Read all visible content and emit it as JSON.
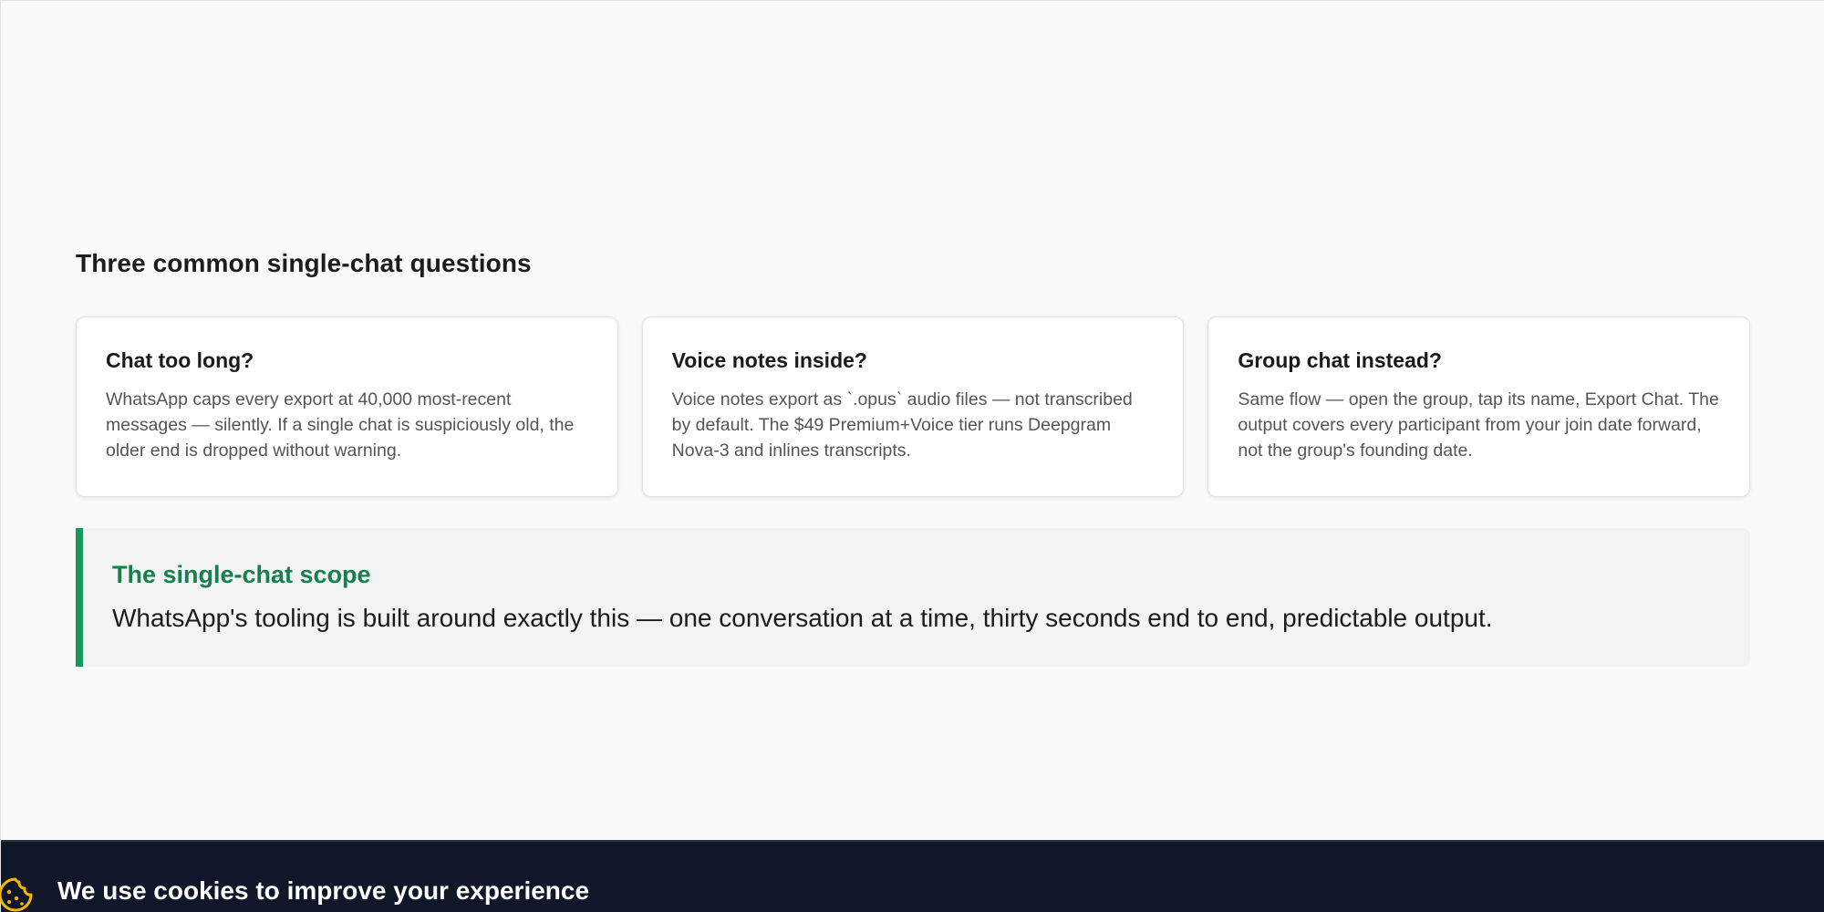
{
  "faq": {
    "title": "Three common single-chat questions",
    "cards": [
      {
        "title": "Chat too long?",
        "body": "WhatsApp caps every export at 40,000 most-recent messages — silently. If a single chat is suspiciously old, the older end is dropped without warning."
      },
      {
        "title": "Voice notes inside?",
        "body": "Voice notes export as `.opus` audio files — not transcribed by default. The $49 Premium+Voice tier runs Deepgram Nova-3 and inlines transcripts."
      },
      {
        "title": "Group chat instead?",
        "body": "Same flow — open the group, tap its name, Export Chat. The output covers every participant from your join date forward, not the group's founding date."
      }
    ]
  },
  "callout": {
    "title": "The single-chat scope",
    "text": "WhatsApp's tooling is built around exactly this — one conversation at a time, thirty seconds end to end, predictable output."
  },
  "cookie_banner": {
    "icon": "cookie-icon",
    "title": "We use cookies to improve your experience",
    "colors": {
      "background": "#0f1729",
      "icon": "#f5b800"
    }
  },
  "colors": {
    "accent": "#15985c",
    "accent_text": "#157f4f"
  }
}
